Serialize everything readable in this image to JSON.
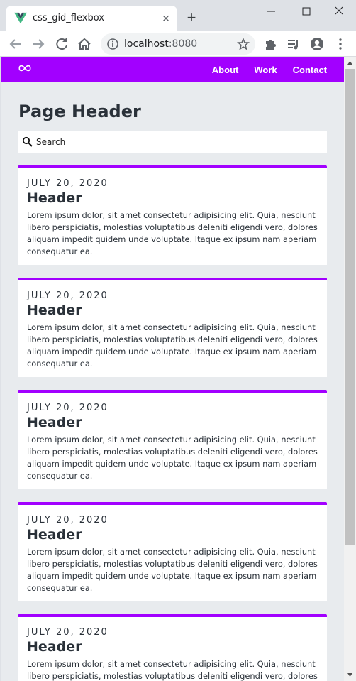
{
  "browser": {
    "tab_title": "css_gid_flexbox",
    "tab_close": "✕",
    "new_tab": "+",
    "url_host": "localhost",
    "url_port": ":8080"
  },
  "navbar": {
    "logo_icon": "infinity-icon",
    "links": [
      "About",
      "Work",
      "Contact"
    ]
  },
  "page": {
    "header": "Page Header",
    "search_placeholder": "Search"
  },
  "cards": [
    {
      "date": "JULY 20, 2020",
      "title": "Header",
      "body": "Lorem ipsum dolor, sit amet consectetur adipisicing elit. Quia, nesciunt libero perspiciatis, molestias voluptatibus deleniti eligendi vero, dolores aliquam impedit quidem unde voluptate. Itaque ex ipsum nam aperiam consequatur ea."
    },
    {
      "date": "JULY 20, 2020",
      "title": "Header",
      "body": "Lorem ipsum dolor, sit amet consectetur adipisicing elit. Quia, nesciunt libero perspiciatis, molestias voluptatibus deleniti eligendi vero, dolores aliquam impedit quidem unde voluptate. Itaque ex ipsum nam aperiam consequatur ea."
    },
    {
      "date": "JULY 20, 2020",
      "title": "Header",
      "body": "Lorem ipsum dolor, sit amet consectetur adipisicing elit. Quia, nesciunt libero perspiciatis, molestias voluptatibus deleniti eligendi vero, dolores aliquam impedit quidem unde voluptate. Itaque ex ipsum nam aperiam consequatur ea."
    },
    {
      "date": "JULY 20, 2020",
      "title": "Header",
      "body": "Lorem ipsum dolor, sit amet consectetur adipisicing elit. Quia, nesciunt libero perspiciatis, molestias voluptatibus deleniti eligendi vero, dolores aliquam impedit quidem unde voluptate. Itaque ex ipsum nam aperiam consequatur ea."
    },
    {
      "date": "JULY 20, 2020",
      "title": "Header",
      "body": "Lorem ipsum dolor, sit amet consectetur adipisicing elit. Quia, nesciunt libero perspiciatis, molestias voluptatibus deleniti eligendi vero, dolores aliquam impedit quidem unde voluptate. Itaque ex ipsum nam aperiam consequatur ea."
    }
  ],
  "colors": {
    "accent": "#a200ff",
    "page_background": "#e8ebee",
    "text": "#2a3139"
  }
}
